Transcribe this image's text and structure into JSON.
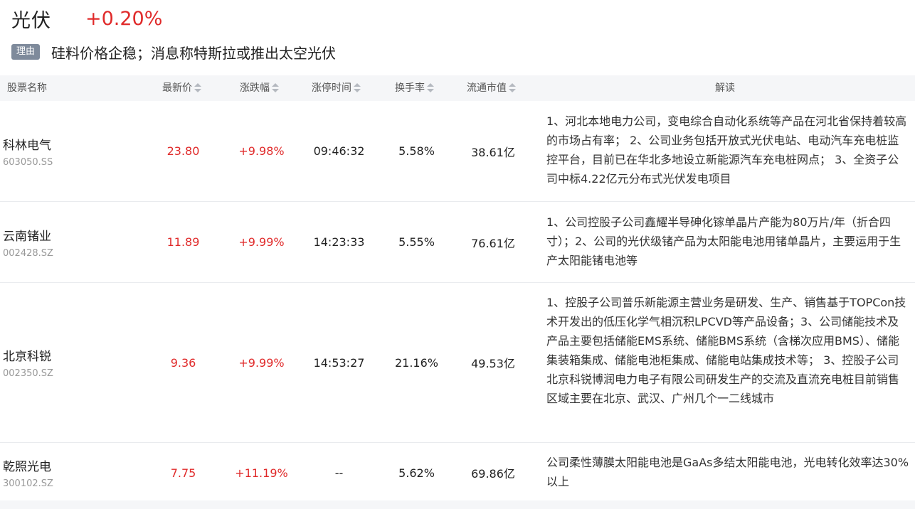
{
  "header": {
    "sector_name": "光伏",
    "sector_change": "+0.20%",
    "reason_tag": "理由",
    "reason_text": "硅料价格企稳；消息称特斯拉或推出太空光伏"
  },
  "columns": {
    "name": "股票名称",
    "price": "最新价",
    "change": "涨跌幅",
    "limit_time": "涨停时间",
    "turnover": "换手率",
    "market_cap": "流通市值",
    "interpretation": "解读"
  },
  "colors": {
    "up": "#e02a2a",
    "header_bg": "#f5f6f8",
    "tag_bg": "#7e8a9b"
  },
  "rows": [
    {
      "name": "科林电气",
      "code": "603050.SS",
      "price": "23.80",
      "change": "+9.98%",
      "limit_time": "09:46:32",
      "turnover": "5.58%",
      "market_cap": "38.61亿",
      "desc": "1、河北本地电力公司，变电综合自动化系统等产品在河北省保持着较高的市场占有率； 2、公司业务包括开放式光伏电站、电动汽车充电桩监控平台，目前已在华北多地设立新能源汽车充电桩网点； 3、全资子公司中标4.22亿元分布式光伏发电项目"
    },
    {
      "name": "云南锗业",
      "code": "002428.SZ",
      "price": "11.89",
      "change": "+9.99%",
      "limit_time": "14:23:33",
      "turnover": "5.55%",
      "market_cap": "76.61亿",
      "desc": "1、公司控股子公司鑫耀半导砷化镓单晶片产能为80万片/年（折合四寸）；2、公司的光伏级锗产品为太阳能电池用锗单晶片，主要运用于生产太阳能锗电池等"
    },
    {
      "name": "北京科锐",
      "code": "002350.SZ",
      "price": "9.36",
      "change": "+9.99%",
      "limit_time": "14:53:27",
      "turnover": "21.16%",
      "market_cap": "49.53亿",
      "desc": "1、控股子公司普乐新能源主营业务是研发、生产、销售基于TOPCon技术开发出的低压化学气相沉积LPCVD等产品设备；3、公司储能技术及产品主要包括储能EMS系统、储能BMS系统（含梯次应用BMS）、储能集装箱集成、储能电池柜集成、储能电站集成技术等； 3、控股子公司北京科锐博润电力电子有限公司研发生产的交流及直流充电桩目前销售区域主要在北京、武汉、广州几个一二线城市"
    },
    {
      "name": "乾照光电",
      "code": "300102.SZ",
      "price": "7.75",
      "change": "+11.19%",
      "limit_time": "--",
      "turnover": "5.62%",
      "market_cap": "69.86亿",
      "desc": "公司柔性薄膜太阳能电池是GaAs多结太阳能电池，光电转化效率达30%以上"
    }
  ]
}
